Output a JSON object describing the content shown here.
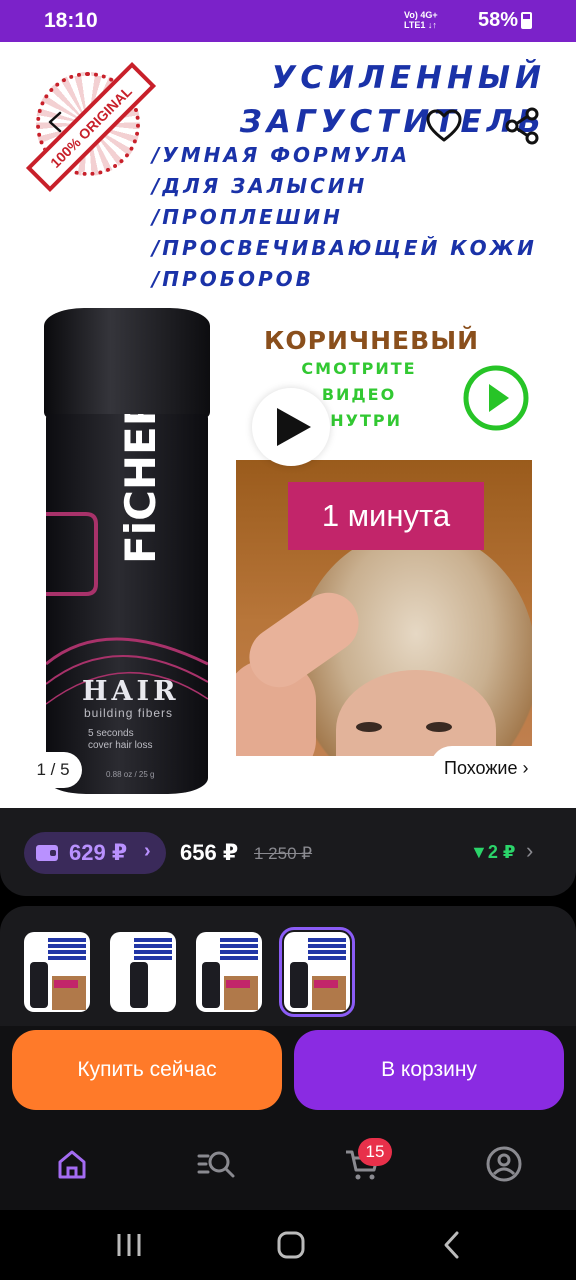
{
  "status_bar": {
    "time": "18:10",
    "network": "Vo) 4G+ LTE1",
    "battery_text": "58%",
    "battery_level": 0.58
  },
  "banner": {
    "headline": [
      "УСИЛЕННЫЙ",
      "ЗАГУСТИТЕЛЬ"
    ],
    "bullets": [
      "/УМНАЯ ФОРМУЛА",
      "/ДЛЯ ЗАЛЫСИН",
      "/ПРОПЛЕШИН",
      "/ПРОСВЕЧИВАЮЩЕЙ КОЖИ",
      "/ПРОБОРОВ"
    ],
    "stamp_text": "100% ORIGINAL",
    "color_label": "КОРИЧНЕВЫЙ",
    "watch_text": [
      "СМОТРИТЕ",
      "ВИДЕО",
      "ВНУТРИ"
    ],
    "video_label": "1 минута",
    "bottle": {
      "brand": "FiCHER",
      "hair": "HAIR",
      "sub": "building fibers",
      "tiny": [
        "5 seconds",
        "cover hair loss"
      ],
      "net": "0.88 oz / 25 g"
    }
  },
  "gallery": {
    "counter": "1 / 5",
    "similar_label": "Похожие ›"
  },
  "price": {
    "wallet_price": "629 ₽",
    "wallet_chevron": "›",
    "main": "656 ₽",
    "old": "1 250 ₽",
    "discount": "▼2 ₽"
  },
  "actions": {
    "buy_now": "Купить сейчас",
    "add_to_cart": "В корзину"
  },
  "tabbar": {
    "cart_badge": "15"
  },
  "colors": {
    "accent": "#8a2be2",
    "buy": "#ff7a29",
    "status_bar": "#7b22c9",
    "banner_text": "#1a32a8",
    "discount": "#2bd46a"
  }
}
